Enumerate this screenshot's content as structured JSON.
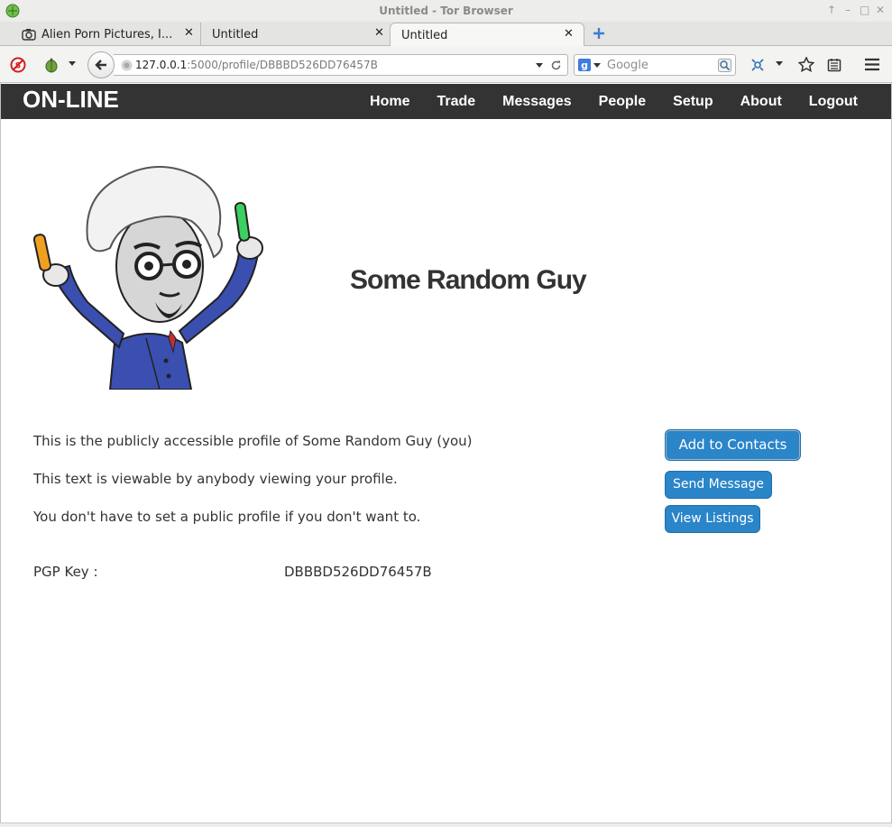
{
  "window": {
    "title": "Untitled - Tor Browser"
  },
  "tabs": [
    {
      "label": "Alien Porn Pictures, I...",
      "active": false
    },
    {
      "label": "Untitled",
      "active": false
    },
    {
      "label": "Untitled",
      "active": true
    }
  ],
  "toolbar": {
    "url_host": "127.0.0.1",
    "url_path": ":5000/profile/DBBBD526DD76457B",
    "search_placeholder": "Google"
  },
  "site": {
    "logo": "ON-LINE",
    "nav": [
      "Home",
      "Trade",
      "Messages",
      "People",
      "Setup",
      "About",
      "Logout"
    ]
  },
  "profile": {
    "name": "Some Random Guy",
    "bio": [
      "This is the publicly accessible profile of Some Random Guy (you)",
      "This text is viewable by anybody viewing your profile.",
      "You don't have to set a public profile if you don't want to."
    ],
    "pgp_label": "PGP Key :",
    "pgp_value": "DBBBD526DD76457B"
  },
  "actions": {
    "add_contacts": "Add to Contacts",
    "send_message": "Send Message",
    "view_listings": "View Listings"
  },
  "colors": {
    "header_bg": "#333333",
    "button_bg": "#2a85c9",
    "text": "#333333"
  }
}
